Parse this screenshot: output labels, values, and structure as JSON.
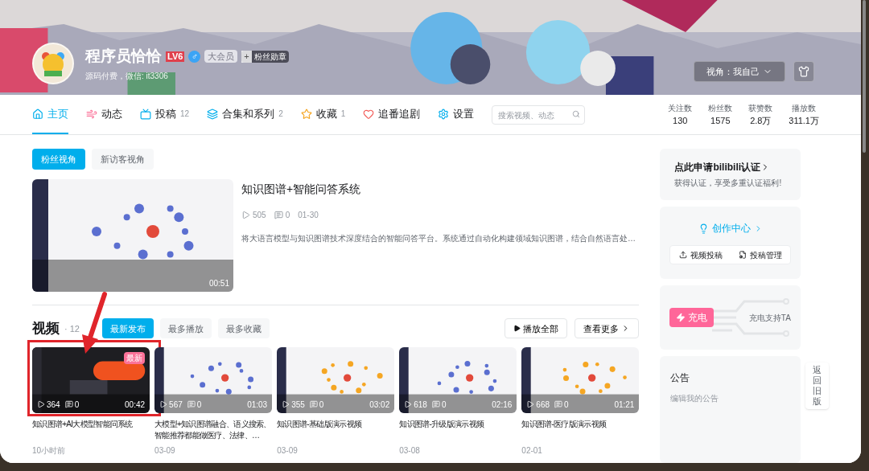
{
  "profile": {
    "name": "程序员恰恰",
    "level": "LV6",
    "gender": "♂",
    "vip": "大会员",
    "vip_active": false,
    "medal_plus": "+",
    "medal": "粉丝勋章",
    "sign": "源码付费，微信: it3306",
    "view_select": "视角：我自己"
  },
  "tabs": [
    {
      "label": "主页",
      "selected": true,
      "kind": "home"
    },
    {
      "label": "动态",
      "selected": false,
      "kind": "dynamic"
    },
    {
      "label": "投稿",
      "count": "12",
      "selected": false,
      "kind": "upload"
    },
    {
      "label": "合集和系列",
      "count": "2",
      "selected": false,
      "kind": "series"
    },
    {
      "label": "收藏",
      "count": "1",
      "selected": false,
      "kind": "fav"
    },
    {
      "label": "追番追剧",
      "selected": false,
      "kind": "bangumi"
    },
    {
      "label": "设置",
      "selected": false,
      "kind": "settings"
    }
  ],
  "search": {
    "placeholder": "搜索视频、动态"
  },
  "stats": [
    {
      "label": "关注数",
      "value": "130"
    },
    {
      "label": "粉丝数",
      "value": "1575"
    },
    {
      "label": "获赞数",
      "value": "2.8万"
    },
    {
      "label": "播放数",
      "value": "311.1万"
    }
  ],
  "perspective": [
    {
      "label": "粉丝视角",
      "selected": true
    },
    {
      "label": "新访客视角",
      "selected": false
    }
  ],
  "featured": {
    "title": "知识图谱+智能问答系统",
    "plays": "505",
    "comments": "0",
    "date": "01-30",
    "duration": "00:51",
    "description": "将大语言模型与知识图谱技术深度结合的智能问答平台。系统通过自动化构建领域知识图谱，结合自然语言处…"
  },
  "videos_section": {
    "title": "视频",
    "count": "· 12",
    "sorts": [
      {
        "label": "最新发布",
        "selected": true
      },
      {
        "label": "最多播放",
        "selected": false
      },
      {
        "label": "最多收藏",
        "selected": false
      }
    ],
    "play_all": "播放全部",
    "more": "查看更多"
  },
  "videos": [
    {
      "title": "知识图谱+AI大模型智能问系统",
      "plays": "364",
      "comments": "0",
      "duration": "00:42",
      "date": "10小时前",
      "badge": "最新",
      "highlighted": true
    },
    {
      "title": "大模型+知识图谱融合、语义搜索、智能推荐都能做医疗、法律、…",
      "plays": "567",
      "comments": "0",
      "duration": "01:03",
      "date": "03-09",
      "highlighted": false
    },
    {
      "title": "知识图谱-基础版演示视频",
      "plays": "355",
      "comments": "0",
      "duration": "03:02",
      "date": "03-09",
      "highlighted": false
    },
    {
      "title": "知识图谱-升级版演示视频",
      "plays": "618",
      "comments": "0",
      "duration": "02:16",
      "date": "03-08",
      "highlighted": false
    },
    {
      "title": "知识图谱-医疗版演示视频",
      "plays": "668",
      "comments": "0",
      "duration": "01:21",
      "date": "02-01",
      "highlighted": false
    }
  ],
  "sidebar": {
    "verify_title": "点此申请bilibili认证",
    "verify_sub": "获得认证，享受多重认证福利!",
    "creator": "创作中心",
    "creator_actions": [
      "视频投稿",
      "投稿管理"
    ],
    "charge": "充电",
    "charge_sub": "充电支持TA",
    "notice_title": "公告",
    "notice_placeholder": "编辑我的公告"
  },
  "float_button": "返回旧版"
}
